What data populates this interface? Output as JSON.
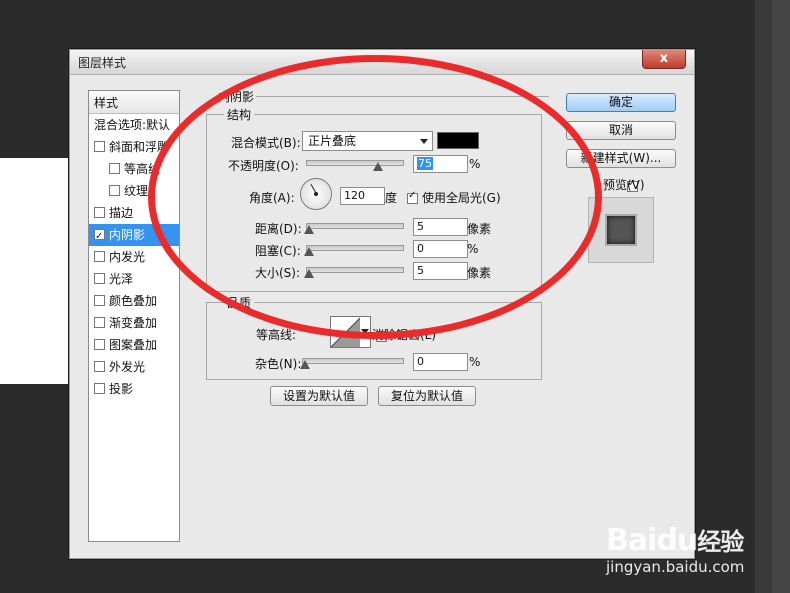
{
  "dialog": {
    "title": "图层样式",
    "close_label": "x"
  },
  "styles_panel": {
    "header": "样式",
    "items": [
      {
        "label": "混合选项:默认",
        "checkbox": false,
        "checked": false,
        "indent": false,
        "selected": false
      },
      {
        "label": "斜面和浮雕",
        "checkbox": true,
        "checked": false,
        "indent": false,
        "selected": false
      },
      {
        "label": "等高线",
        "checkbox": true,
        "checked": false,
        "indent": true,
        "selected": false
      },
      {
        "label": "纹理",
        "checkbox": true,
        "checked": false,
        "indent": true,
        "selected": false
      },
      {
        "label": "描边",
        "checkbox": true,
        "checked": false,
        "indent": false,
        "selected": false
      },
      {
        "label": "内阴影",
        "checkbox": true,
        "checked": true,
        "indent": false,
        "selected": true
      },
      {
        "label": "内发光",
        "checkbox": true,
        "checked": false,
        "indent": false,
        "selected": false
      },
      {
        "label": "光泽",
        "checkbox": true,
        "checked": false,
        "indent": false,
        "selected": false
      },
      {
        "label": "颜色叠加",
        "checkbox": true,
        "checked": false,
        "indent": false,
        "selected": false
      },
      {
        "label": "渐变叠加",
        "checkbox": true,
        "checked": false,
        "indent": false,
        "selected": false
      },
      {
        "label": "图案叠加",
        "checkbox": true,
        "checked": false,
        "indent": false,
        "selected": false
      },
      {
        "label": "外发光",
        "checkbox": true,
        "checked": false,
        "indent": false,
        "selected": false
      },
      {
        "label": "投影",
        "checkbox": true,
        "checked": false,
        "indent": false,
        "selected": false
      }
    ]
  },
  "inner_shadow": {
    "section_title": "内阴影",
    "structure": {
      "title": "结构",
      "blend_mode_label": "混合模式(B):",
      "blend_mode_value": "正片叠底",
      "blend_color": "#000000",
      "opacity_label": "不透明度(O):",
      "opacity_value": "75",
      "opacity_unit": "%",
      "opacity_fraction": 0.75,
      "angle_label": "角度(A):",
      "angle_value": "120",
      "angle_unit": "度",
      "global_light_label": "使用全局光(G)",
      "global_light_checked": true,
      "distance_label": "距离(D):",
      "distance_value": "5",
      "distance_unit": "像素",
      "choke_label": "阻塞(C):",
      "choke_value": "0",
      "choke_unit": "%",
      "size_label": "大小(S):",
      "size_value": "5",
      "size_unit": "像素"
    },
    "quality": {
      "title": "品质",
      "contour_label": "等高线:",
      "antialias_label": "消除锯齿(L)",
      "antialias_checked": false,
      "noise_label": "杂色(N):",
      "noise_value": "0",
      "noise_unit": "%"
    },
    "make_default_label": "设置为默认值",
    "reset_default_label": "复位为默认值"
  },
  "buttons": {
    "ok": "确定",
    "cancel": "取消",
    "new_style": "新建样式(W)...",
    "preview_label": "预览(V)",
    "preview_checked": true
  },
  "annotation": {
    "color": "#ea2b2b"
  },
  "watermark": {
    "brand": "Baidu",
    "brand_cn": "经验",
    "url": "jingyan.baidu.com"
  }
}
